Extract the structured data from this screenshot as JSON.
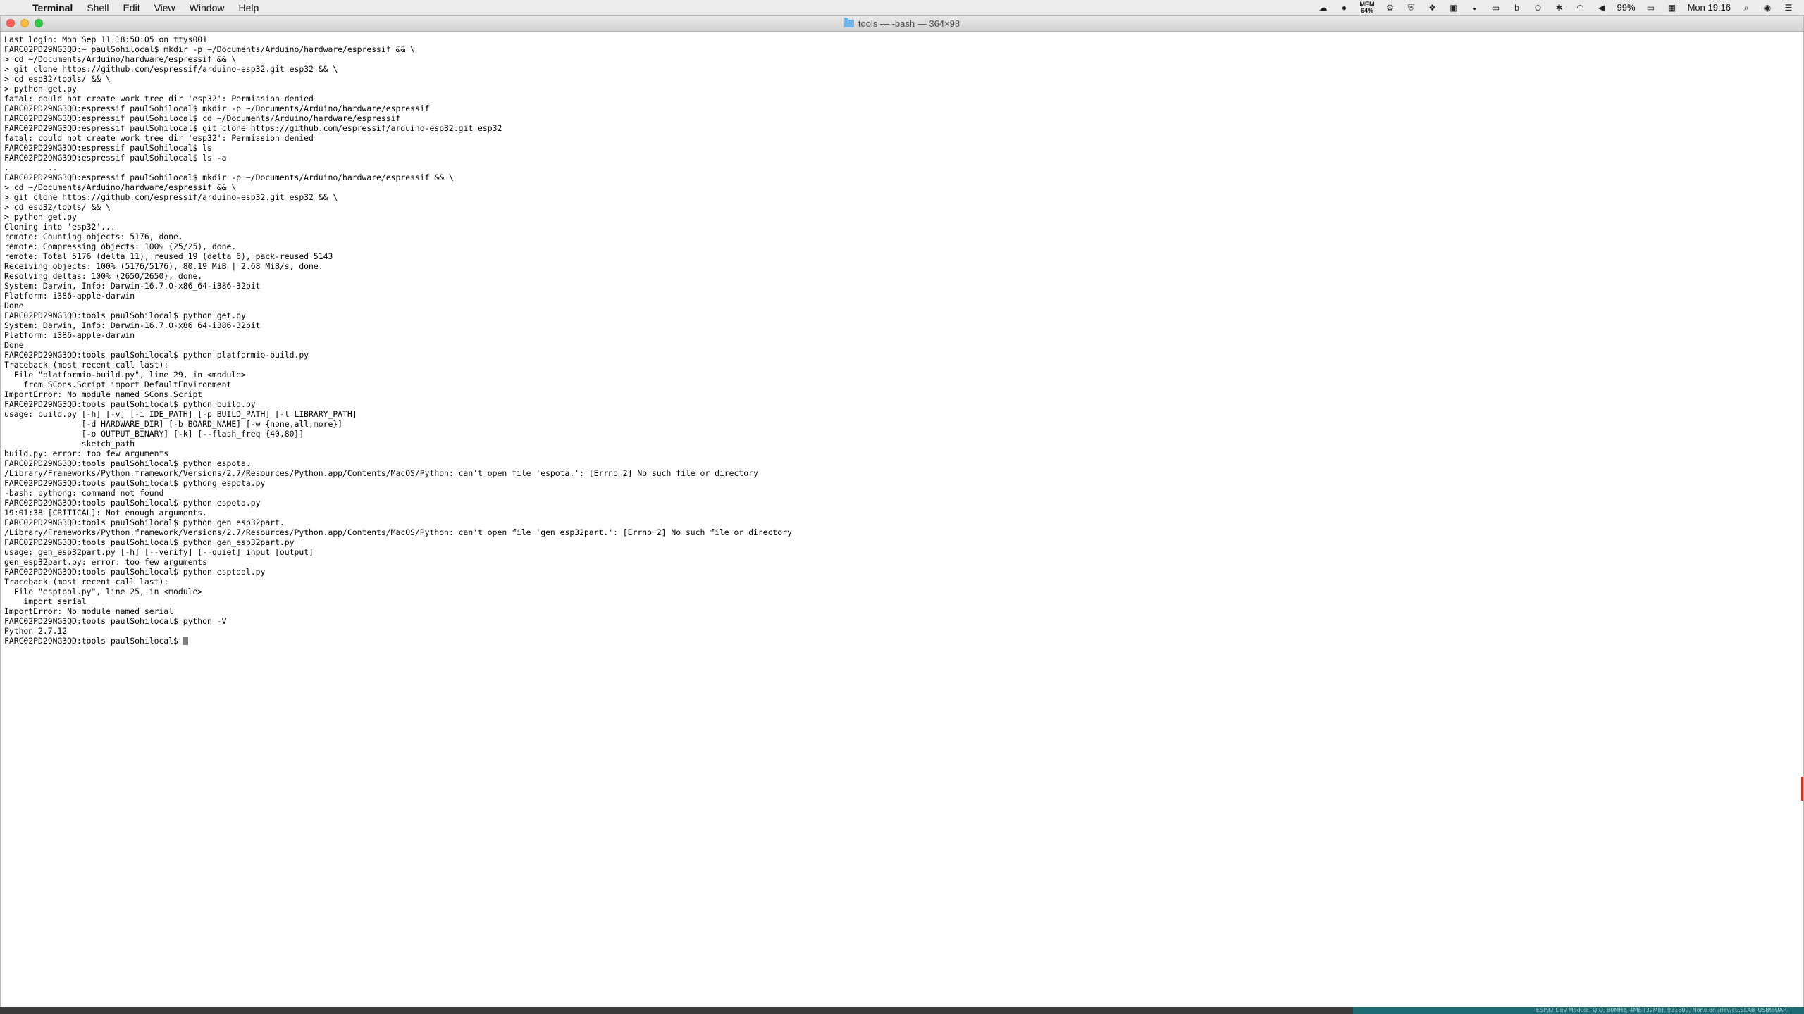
{
  "menubar": {
    "app_name": "Terminal",
    "menus": [
      "Shell",
      "Edit",
      "View",
      "Window",
      "Help"
    ],
    "status": {
      "mem_label": "MEM",
      "mem_value": "64%",
      "battery": "99%",
      "clock": "Mon 19:16"
    }
  },
  "window": {
    "title": "tools — -bash — 364×98"
  },
  "terminal": {
    "lines": [
      "Last login: Mon Sep 11 18:50:05 on ttys001",
      "FARC02PD29NG3QD:~ paulSohilocal$ mkdir -p ~/Documents/Arduino/hardware/espressif && \\",
      "> cd ~/Documents/Arduino/hardware/espressif && \\",
      "> git clone https://github.com/espressif/arduino-esp32.git esp32 && \\",
      "> cd esp32/tools/ && \\",
      "> python get.py",
      "fatal: could not create work tree dir 'esp32': Permission denied",
      "FARC02PD29NG3QD:espressif paulSohilocal$ mkdir -p ~/Documents/Arduino/hardware/espressif",
      "FARC02PD29NG3QD:espressif paulSohilocal$ cd ~/Documents/Arduino/hardware/espressif",
      "FARC02PD29NG3QD:espressif paulSohilocal$ git clone https://github.com/espressif/arduino-esp32.git esp32",
      "fatal: could not create work tree dir 'esp32': Permission denied",
      "FARC02PD29NG3QD:espressif paulSohilocal$ ls",
      "FARC02PD29NG3QD:espressif paulSohilocal$ ls -a",
      ".        ..",
      "FARC02PD29NG3QD:espressif paulSohilocal$ mkdir -p ~/Documents/Arduino/hardware/espressif && \\",
      "> cd ~/Documents/Arduino/hardware/espressif && \\",
      "> git clone https://github.com/espressif/arduino-esp32.git esp32 && \\",
      "> cd esp32/tools/ && \\",
      "> python get.py",
      "Cloning into 'esp32'...",
      "remote: Counting objects: 5176, done.",
      "remote: Compressing objects: 100% (25/25), done.",
      "remote: Total 5176 (delta 11), reused 19 (delta 6), pack-reused 5143",
      "Receiving objects: 100% (5176/5176), 80.19 MiB | 2.68 MiB/s, done.",
      "Resolving deltas: 100% (2650/2650), done.",
      "System: Darwin, Info: Darwin-16.7.0-x86_64-i386-32bit",
      "Platform: i386-apple-darwin",
      "Done",
      "FARC02PD29NG3QD:tools paulSohilocal$ python get.py",
      "System: Darwin, Info: Darwin-16.7.0-x86_64-i386-32bit",
      "Platform: i386-apple-darwin",
      "Done",
      "FARC02PD29NG3QD:tools paulSohilocal$ python platformio-build.py",
      "Traceback (most recent call last):",
      "  File \"platformio-build.py\", line 29, in <module>",
      "    from SCons.Script import DefaultEnvironment",
      "ImportError: No module named SCons.Script",
      "FARC02PD29NG3QD:tools paulSohilocal$ python build.py",
      "usage: build.py [-h] [-v] [-i IDE_PATH] [-p BUILD_PATH] [-l LIBRARY_PATH]",
      "                [-d HARDWARE_DIR] [-b BOARD_NAME] [-w {none,all,more}]",
      "                [-o OUTPUT_BINARY] [-k] [--flash_freq {40,80}]",
      "                sketch_path",
      "build.py: error: too few arguments",
      "FARC02PD29NG3QD:tools paulSohilocal$ python espota.",
      "/Library/Frameworks/Python.framework/Versions/2.7/Resources/Python.app/Contents/MacOS/Python: can't open file 'espota.': [Errno 2] No such file or directory",
      "FARC02PD29NG3QD:tools paulSohilocal$ pythong espota.py",
      "-bash: pythong: command not found",
      "FARC02PD29NG3QD:tools paulSohilocal$ python espota.py",
      "19:01:38 [CRITICAL]: Not enough arguments.",
      "FARC02PD29NG3QD:tools paulSohilocal$ python gen_esp32part.",
      "/Library/Frameworks/Python.framework/Versions/2.7/Resources/Python.app/Contents/MacOS/Python: can't open file 'gen_esp32part.': [Errno 2] No such file or directory",
      "FARC02PD29NG3QD:tools paulSohilocal$ python gen_esp32part.py",
      "usage: gen_esp32part.py [-h] [--verify] [--quiet] input [output]",
      "gen_esp32part.py: error: too few arguments",
      "FARC02PD29NG3QD:tools paulSohilocal$ python esptool.py",
      "Traceback (most recent call last):",
      "  File \"esptool.py\", line 25, in <module>",
      "    import serial",
      "ImportError: No module named serial",
      "FARC02PD29NG3QD:tools paulSohilocal$ python -V",
      "Python 2.7.12",
      "FARC02PD29NG3QD:tools paulSohilocal$ "
    ]
  },
  "footer": {
    "status_text": "ESP32 Dev Module, QIO, 80MHz, 4MB (32Mb), 921600, None on /dev/cu.SLAB_USBtoUART"
  }
}
